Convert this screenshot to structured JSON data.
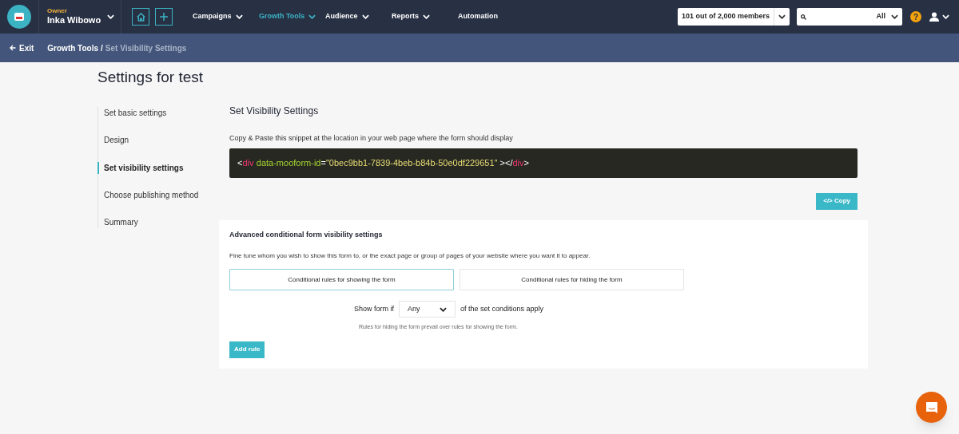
{
  "header": {
    "account": {
      "role": "Owner",
      "name": "Inka Wibowo"
    },
    "nav": [
      {
        "label": "Campaigns",
        "selected": false,
        "menu": true
      },
      {
        "label": "Growth Tools",
        "selected": true,
        "menu": true
      },
      {
        "label": "Audience",
        "selected": false,
        "menu": true
      },
      {
        "label": "Reports",
        "selected": false,
        "menu": true
      },
      {
        "label": "Automation",
        "selected": false,
        "menu": false
      }
    ],
    "members": "101 out of 2,000 members",
    "search_scope": "All",
    "help": "?"
  },
  "breadcrumb": {
    "exit": "Exit",
    "parent": "Growth Tools",
    "separator": "/",
    "current": "Set Visibility Settings"
  },
  "page_title": "Settings for test",
  "steps": [
    {
      "label": "Set basic settings",
      "selected": false
    },
    {
      "label": "Design",
      "selected": false
    },
    {
      "label": "Set visibility settings",
      "selected": true
    },
    {
      "label": "Choose publishing method",
      "selected": false
    },
    {
      "label": "Summary",
      "selected": false
    }
  ],
  "section_title": "Set Visibility Settings",
  "snippet_hint": "Copy & Paste this snippet at the location in your web page where the form should display",
  "snippet": [
    {
      "kind": "punct",
      "text": "<"
    },
    {
      "kind": "tag",
      "text": "div"
    },
    {
      "kind": "attr",
      "text": "data-mooform-id"
    },
    {
      "kind": "punct",
      "text": "="
    },
    {
      "kind": "string",
      "text": "\"0bec9bb1-7839-4beb-b84b-50e0df229651\""
    },
    {
      "kind": "punct",
      "text": " ></"
    },
    {
      "kind": "tag",
      "text": "div"
    },
    {
      "kind": "punct",
      "text": ">"
    }
  ],
  "copy_button": "</> Copy",
  "advanced": {
    "title": "Advanced conditional form visibility settings",
    "description": "Fine tune whom you wish to show this form to, or the exact page or group of pages of your website where you want it to appear.",
    "tabs": [
      {
        "label": "Conditional rules for showing the form",
        "selected": true
      },
      {
        "label": "Conditional rules for hiding the form",
        "selected": false
      }
    ],
    "condition_prefix": "Show form if",
    "condition_value": "Any",
    "condition_suffix": "of the set conditions apply",
    "note": "Rules for hiding the form prevail over rules for showing the form.",
    "add_rule": "Add rule"
  }
}
